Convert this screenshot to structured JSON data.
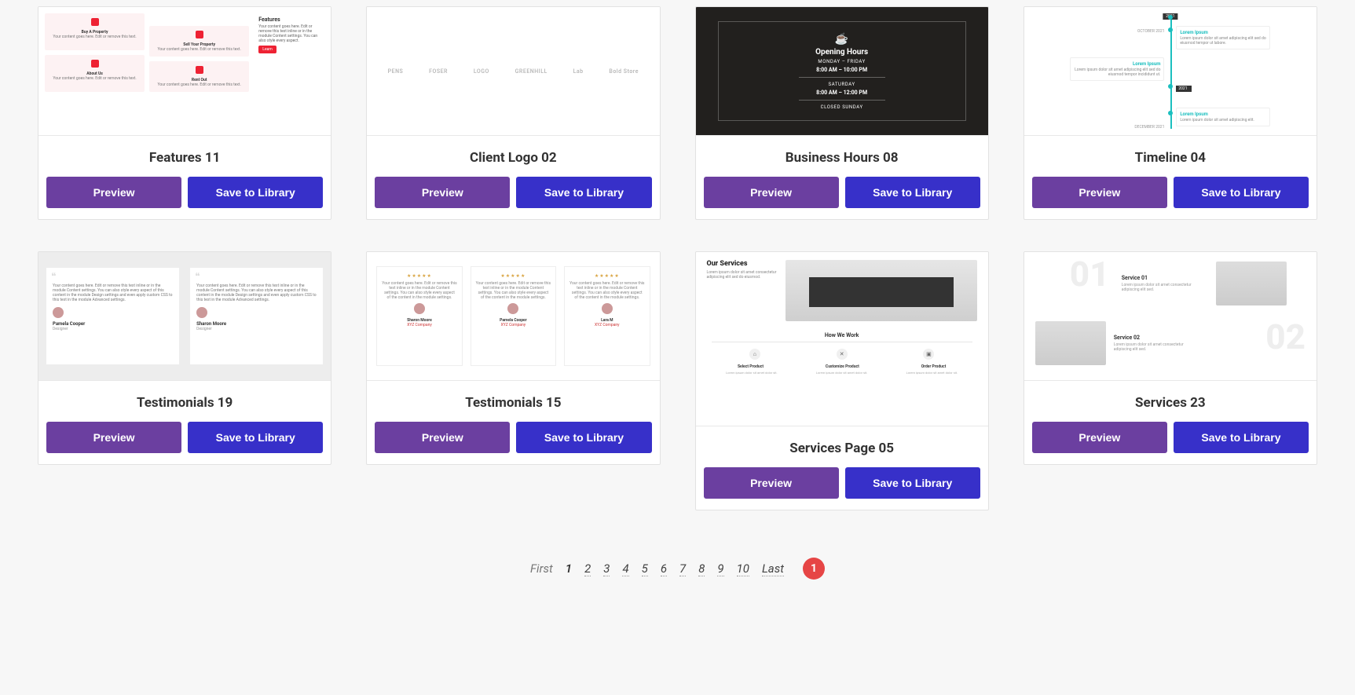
{
  "buttons": {
    "preview": "Preview",
    "save": "Save to Library"
  },
  "cards": [
    {
      "title": "Features 11"
    },
    {
      "title": "Client Logo 02"
    },
    {
      "title": "Business Hours 08"
    },
    {
      "title": "Timeline 04"
    },
    {
      "title": "Testimonials 19"
    },
    {
      "title": "Testimonials 15"
    },
    {
      "title": "Services Page 05"
    },
    {
      "title": "Services 23"
    }
  ],
  "thumbs": {
    "features11": {
      "panel_title": "Features",
      "panel_button": "Learn",
      "boxes": [
        "Buy A Property",
        "Sell Your Property",
        "About Us",
        "Rent Out"
      ]
    },
    "logos": [
      "PENS",
      "FOSER",
      "LOGO",
      "GREENHILL",
      "Lab",
      "Bold Store"
    ],
    "hours": {
      "title": "Opening Hours",
      "rows": [
        {
          "label": "MONDAY – FRIDAY",
          "time": "8:00 AM – 10:00 PM"
        },
        {
          "label": "SATURDAY",
          "time": "8:00 AM – 12:00 PM"
        },
        {
          "label": "CLOSED SUNDAY",
          "time": ""
        }
      ]
    },
    "timeline": {
      "datebox": "2021",
      "dates": [
        "OCTOBER 2021",
        "DECEMBER 2021"
      ],
      "items": [
        "Lorem Ipsum",
        "Lorem Ipsum",
        "Lorem Ipsum"
      ]
    },
    "test19": {
      "people": [
        {
          "name": "Pamela Cooper",
          "role": "Designer"
        },
        {
          "name": "Sharon Moore",
          "role": "Designer"
        }
      ]
    },
    "test15": {
      "people": [
        {
          "name": "Sharon Moore",
          "company": "XYZ Company"
        },
        {
          "name": "Pamela Cooper",
          "company": "XYZ Company"
        },
        {
          "name": "Lara M",
          "company": "XYZ Company"
        }
      ]
    },
    "servicesPage": {
      "heading": "Our Services",
      "subheading": "How We Work",
      "steps": [
        "Select Product",
        "Customize Product",
        "Order Product"
      ]
    },
    "services23": {
      "rows": [
        {
          "num": "01",
          "title": "Service 01"
        },
        {
          "num": "02",
          "title": "Service 02"
        }
      ]
    }
  },
  "pagination": {
    "first": "First",
    "current": "1",
    "pages": [
      "2",
      "3",
      "4",
      "5",
      "6",
      "7",
      "8",
      "9",
      "10"
    ],
    "last": "Last",
    "badge": "1"
  }
}
